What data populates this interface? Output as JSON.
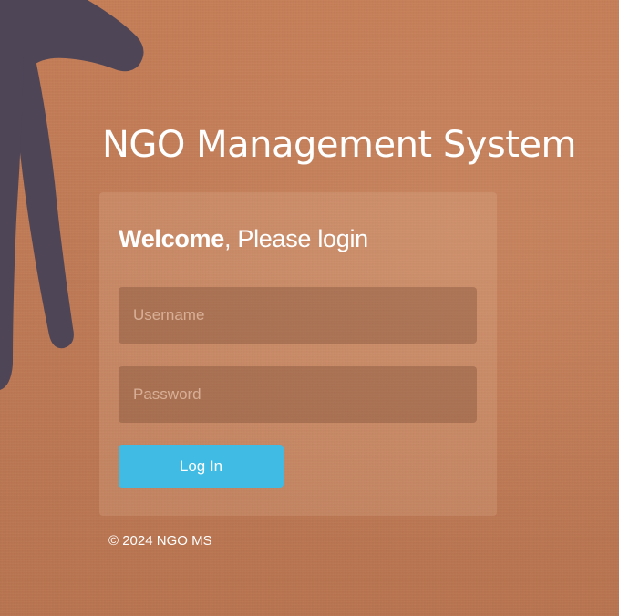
{
  "app": {
    "title": "NGO Management System"
  },
  "login": {
    "welcome_bold": "Welcome",
    "welcome_rest": ", Please login",
    "username_placeholder": "Username",
    "username_value": "",
    "password_placeholder": "Password",
    "password_value": "",
    "login_button_label": "Log In"
  },
  "footer": {
    "copyright": "© 2024 NGO MS"
  },
  "colors": {
    "background": "#c07b55",
    "button": "#3fbbe4",
    "decoration": "#4e4557"
  },
  "decoration": {
    "icon": "hand-silhouette-icon"
  }
}
